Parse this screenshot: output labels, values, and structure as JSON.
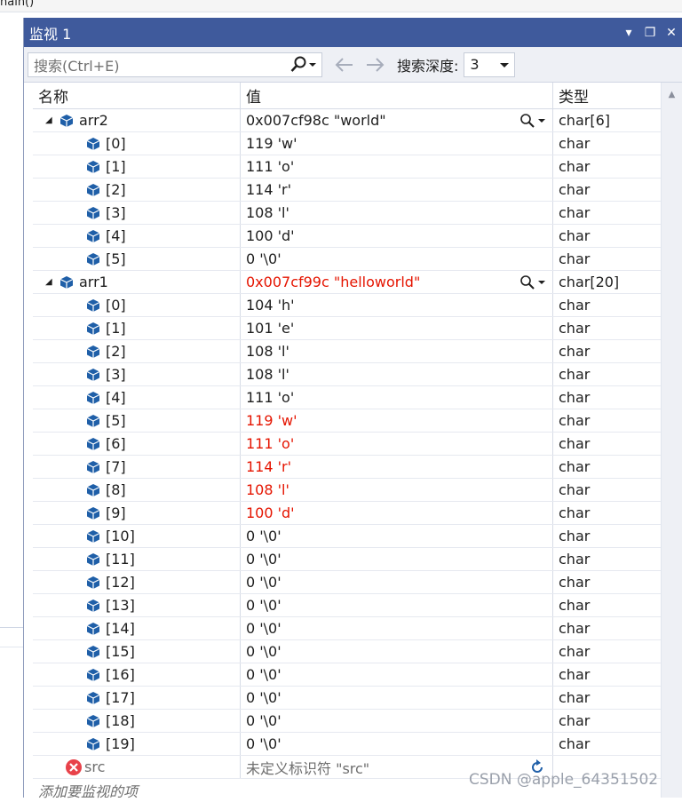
{
  "editor": {
    "top_text": "nain()"
  },
  "window": {
    "title": "监视 1",
    "dropdown_glyph": "▾",
    "pin_glyph": "❐",
    "close_glyph": "✕"
  },
  "toolbar": {
    "search_placeholder": "搜索(Ctrl+E)",
    "depth_label": "搜索深度:",
    "depth_value": "3"
  },
  "columns": {
    "name": "名称",
    "value": "值",
    "type": "类型"
  },
  "arr2": {
    "name": "arr2",
    "value": "0x007cf98c \"world\"",
    "type": "char[6]",
    "items": [
      {
        "name": "[0]",
        "value": "119 'w'",
        "type": "char"
      },
      {
        "name": "[1]",
        "value": "111 'o'",
        "type": "char"
      },
      {
        "name": "[2]",
        "value": "114 'r'",
        "type": "char"
      },
      {
        "name": "[3]",
        "value": "108 'l'",
        "type": "char"
      },
      {
        "name": "[4]",
        "value": "100 'd'",
        "type": "char"
      },
      {
        "name": "[5]",
        "value": "0 '\\0'",
        "type": "char"
      }
    ]
  },
  "arr1": {
    "name": "arr1",
    "value": "0x007cf99c \"helloworld\"",
    "type": "char[20]",
    "items": [
      {
        "name": "[0]",
        "value": "104 'h'",
        "type": "char"
      },
      {
        "name": "[1]",
        "value": "101 'e'",
        "type": "char"
      },
      {
        "name": "[2]",
        "value": "108 'l'",
        "type": "char"
      },
      {
        "name": "[3]",
        "value": "108 'l'",
        "type": "char"
      },
      {
        "name": "[4]",
        "value": "111 'o'",
        "type": "char"
      },
      {
        "name": "[5]",
        "value": "119 'w'",
        "type": "char",
        "changed": true
      },
      {
        "name": "[6]",
        "value": "111 'o'",
        "type": "char",
        "changed": true
      },
      {
        "name": "[7]",
        "value": "114 'r'",
        "type": "char",
        "changed": true
      },
      {
        "name": "[8]",
        "value": "108 'l'",
        "type": "char",
        "changed": true
      },
      {
        "name": "[9]",
        "value": "100 'd'",
        "type": "char",
        "changed": true
      },
      {
        "name": "[10]",
        "value": "0 '\\0'",
        "type": "char"
      },
      {
        "name": "[11]",
        "value": "0 '\\0'",
        "type": "char"
      },
      {
        "name": "[12]",
        "value": "0 '\\0'",
        "type": "char"
      },
      {
        "name": "[13]",
        "value": "0 '\\0'",
        "type": "char"
      },
      {
        "name": "[14]",
        "value": "0 '\\0'",
        "type": "char"
      },
      {
        "name": "[15]",
        "value": "0 '\\0'",
        "type": "char"
      },
      {
        "name": "[16]",
        "value": "0 '\\0'",
        "type": "char"
      },
      {
        "name": "[17]",
        "value": "0 '\\0'",
        "type": "char"
      },
      {
        "name": "[18]",
        "value": "0 '\\0'",
        "type": "char"
      },
      {
        "name": "[19]",
        "value": "0 '\\0'",
        "type": "char"
      }
    ]
  },
  "src": {
    "name": "src",
    "value": "未定义标识符 \"src\""
  },
  "add_item_text": "添加要监视的项",
  "watermark": "CSDN @apple_64351502",
  "colors": {
    "titlebar": "#3f5a9c",
    "changed_value": "#e51400",
    "cube_icon": "#1f5fa8",
    "error_icon": "#e8424a"
  }
}
